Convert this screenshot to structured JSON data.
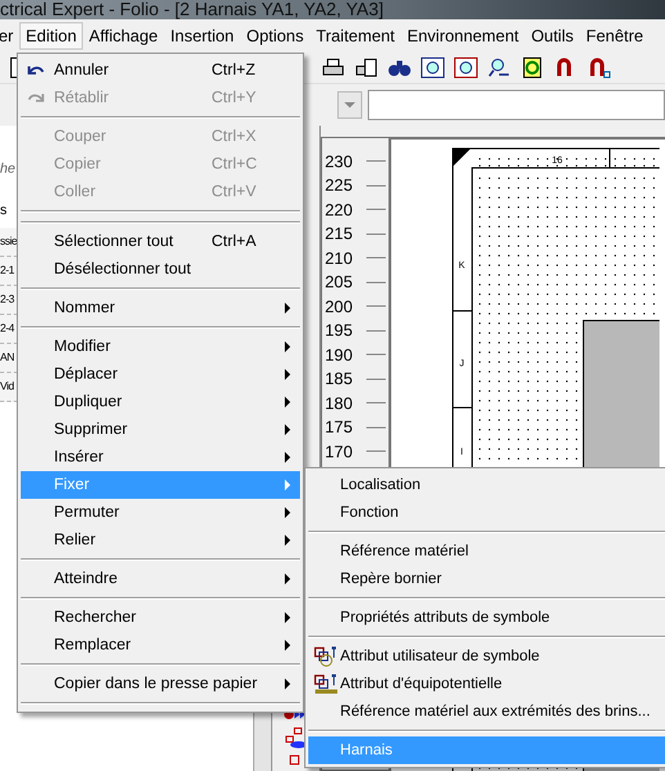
{
  "window": {
    "title": "ctrical Expert - Folio - [2 Harnais YA1, YA2, YA3]"
  },
  "menu_bar": [
    {
      "label": "er",
      "selected": false
    },
    {
      "label": "Edition",
      "selected": true
    },
    {
      "label": "Affichage",
      "selected": false
    },
    {
      "label": "Insertion",
      "selected": false
    },
    {
      "label": "Options",
      "selected": false
    },
    {
      "label": "Traitement",
      "selected": false
    },
    {
      "label": "Environnement",
      "selected": false
    },
    {
      "label": "Outils",
      "selected": false
    },
    {
      "label": "Fenêtre",
      "selected": false
    }
  ],
  "left_panel": {
    "search_fragment": "he",
    "tab_fragment": "s",
    "rows": [
      "ssie",
      "2-1",
      "2-3",
      "2-4",
      "AN",
      "Vid"
    ]
  },
  "ruler": {
    "labels": [
      "230",
      "225",
      "220",
      "215",
      "210",
      "205",
      "200",
      "195",
      "190",
      "185",
      "180",
      "175",
      "170"
    ]
  },
  "sheet": {
    "column_label": "16",
    "row_labels": [
      "K",
      "J",
      "I"
    ]
  },
  "edit_menu": {
    "items": [
      {
        "kind": "item",
        "label": "Annuler",
        "shortcut": "Ctrl+Z",
        "disabled": false,
        "submenu": false,
        "selected": false
      },
      {
        "kind": "item",
        "label": "Rétablir",
        "shortcut": "Ctrl+Y",
        "disabled": true,
        "submenu": false,
        "selected": false
      },
      {
        "kind": "separator"
      },
      {
        "kind": "item",
        "label": "Couper",
        "shortcut": "Ctrl+X",
        "disabled": true,
        "submenu": false,
        "selected": false
      },
      {
        "kind": "item",
        "label": "Copier",
        "shortcut": "Ctrl+C",
        "disabled": true,
        "submenu": false,
        "selected": false
      },
      {
        "kind": "item",
        "label": "Coller",
        "shortcut": "Ctrl+V",
        "disabled": true,
        "submenu": false,
        "selected": false
      },
      {
        "kind": "separator"
      },
      {
        "kind": "separator"
      },
      {
        "kind": "item",
        "label": "Sélectionner tout",
        "shortcut": "Ctrl+A",
        "disabled": false,
        "submenu": false,
        "selected": false
      },
      {
        "kind": "item",
        "label": "Désélectionner tout",
        "disabled": false,
        "submenu": false,
        "selected": false
      },
      {
        "kind": "separator"
      },
      {
        "kind": "item",
        "label": "Nommer",
        "disabled": false,
        "submenu": true,
        "selected": false
      },
      {
        "kind": "separator"
      },
      {
        "kind": "item",
        "label": "Modifier",
        "disabled": false,
        "submenu": true,
        "selected": false
      },
      {
        "kind": "item",
        "label": "Déplacer",
        "disabled": false,
        "submenu": true,
        "selected": false
      },
      {
        "kind": "item",
        "label": "Dupliquer",
        "disabled": false,
        "submenu": true,
        "selected": false
      },
      {
        "kind": "item",
        "label": "Supprimer",
        "disabled": false,
        "submenu": true,
        "selected": false
      },
      {
        "kind": "item",
        "label": "Insérer",
        "disabled": false,
        "submenu": true,
        "selected": false
      },
      {
        "kind": "item",
        "label": "Fixer",
        "disabled": false,
        "submenu": true,
        "selected": true
      },
      {
        "kind": "item",
        "label": "Permuter",
        "disabled": false,
        "submenu": true,
        "selected": false
      },
      {
        "kind": "item",
        "label": "Relier",
        "disabled": false,
        "submenu": true,
        "selected": false
      },
      {
        "kind": "separator"
      },
      {
        "kind": "item",
        "label": "Atteindre",
        "disabled": false,
        "submenu": true,
        "selected": false
      },
      {
        "kind": "separator"
      },
      {
        "kind": "item",
        "label": "Rechercher",
        "disabled": false,
        "submenu": true,
        "selected": false
      },
      {
        "kind": "item",
        "label": "Remplacer",
        "disabled": false,
        "submenu": true,
        "selected": false
      },
      {
        "kind": "separator"
      },
      {
        "kind": "item",
        "label": "Copier dans le presse papier",
        "disabled": false,
        "submenu": true,
        "selected": false
      },
      {
        "kind": "separator"
      }
    ]
  },
  "fixer_submenu": {
    "items": [
      {
        "kind": "item",
        "label": "Localisation",
        "selected": false
      },
      {
        "kind": "item",
        "label": "Fonction",
        "selected": false
      },
      {
        "kind": "separator"
      },
      {
        "kind": "item",
        "label": "Référence matériel",
        "selected": false
      },
      {
        "kind": "item",
        "label": "Repère bornier",
        "selected": false
      },
      {
        "kind": "separator"
      },
      {
        "kind": "item",
        "label": "Propriétés attributs de symbole",
        "selected": false
      },
      {
        "kind": "separator"
      },
      {
        "kind": "item",
        "label": "Attribut utilisateur de symbole",
        "selected": false
      },
      {
        "kind": "item",
        "label": "Attribut d'équipotentielle",
        "selected": false
      },
      {
        "kind": "item",
        "label": "Référence matériel aux extrémités des brins...",
        "selected": false
      },
      {
        "kind": "separator"
      },
      {
        "kind": "item",
        "label": "Harnais",
        "selected": true
      }
    ]
  }
}
